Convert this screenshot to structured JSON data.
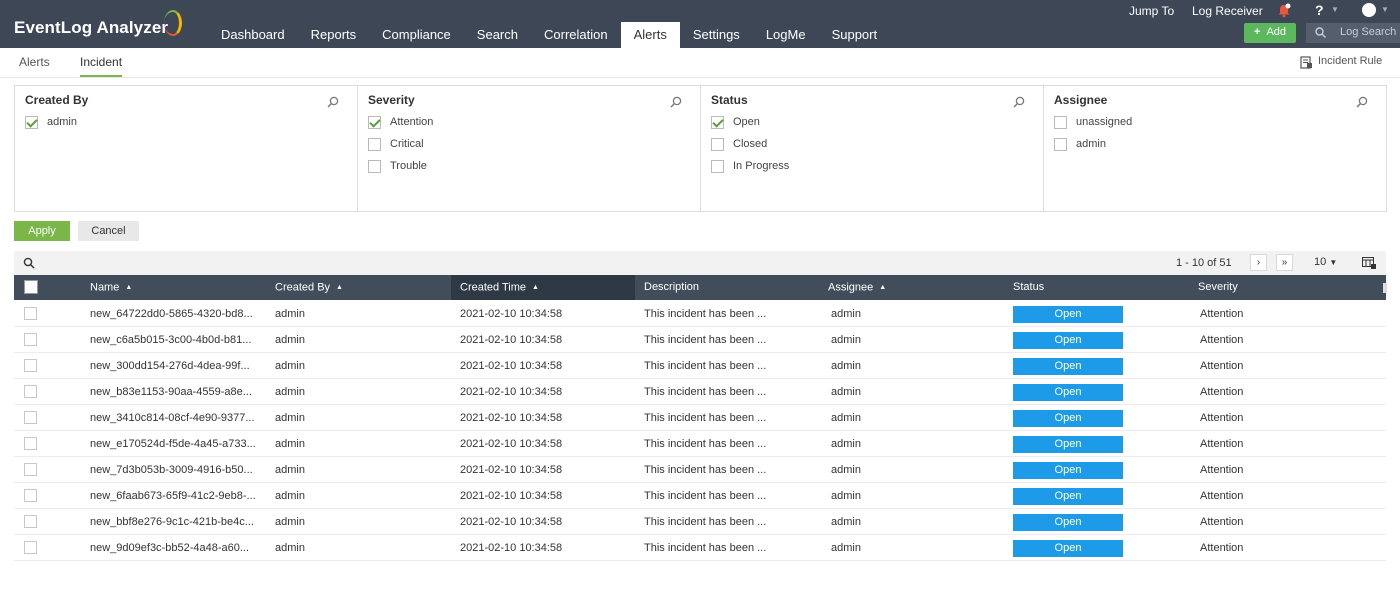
{
  "app": {
    "title": "EventLog Analyzer"
  },
  "nav": [
    {
      "label": "Dashboard",
      "active": false
    },
    {
      "label": "Reports",
      "active": false
    },
    {
      "label": "Compliance",
      "active": false
    },
    {
      "label": "Search",
      "active": false
    },
    {
      "label": "Correlation",
      "active": false
    },
    {
      "label": "Alerts",
      "active": true
    },
    {
      "label": "Settings",
      "active": false
    },
    {
      "label": "LogMe",
      "active": false
    },
    {
      "label": "Support",
      "active": false
    }
  ],
  "top_links": {
    "jump_to": "Jump To",
    "log_receiver": "Log Receiver",
    "help": "?",
    "add": "Add",
    "log_search_placeholder": "Log Search"
  },
  "subtabs": {
    "alerts": "Alerts",
    "incident": "Incident",
    "incident_rule": "Incident Rule"
  },
  "filters": [
    {
      "title": "Created By",
      "options": [
        {
          "label": "admin",
          "checked": true
        }
      ]
    },
    {
      "title": "Severity",
      "options": [
        {
          "label": "Attention",
          "checked": true
        },
        {
          "label": "Critical",
          "checked": false
        },
        {
          "label": "Trouble",
          "checked": false
        }
      ]
    },
    {
      "title": "Status",
      "options": [
        {
          "label": "Open",
          "checked": true
        },
        {
          "label": "Closed",
          "checked": false
        },
        {
          "label": "In Progress",
          "checked": false
        }
      ]
    },
    {
      "title": "Assignee",
      "options": [
        {
          "label": "unassigned",
          "checked": false
        },
        {
          "label": "admin",
          "checked": false
        }
      ]
    }
  ],
  "actions": {
    "apply": "Apply",
    "cancel": "Cancel"
  },
  "pager": {
    "range": "1 - 10 of 51",
    "next": "›",
    "last": "»",
    "per_page": "10"
  },
  "columns": {
    "name": "Name",
    "created_by": "Created By",
    "created_time": "Created Time",
    "description": "Description",
    "assignee": "Assignee",
    "status": "Status",
    "severity": "Severity"
  },
  "sort_glyph": "▲",
  "rows": [
    {
      "name": "new_64722dd0-5865-4320-bd8...",
      "created_by": "admin",
      "created_time": "2021-02-10 10:34:58",
      "description": "This incident has been ...",
      "assignee": "admin",
      "status": "Open",
      "severity": "Attention"
    },
    {
      "name": "new_c6a5b015-3c00-4b0d-b81...",
      "created_by": "admin",
      "created_time": "2021-02-10 10:34:58",
      "description": "This incident has been ...",
      "assignee": "admin",
      "status": "Open",
      "severity": "Attention"
    },
    {
      "name": "new_300dd154-276d-4dea-99f...",
      "created_by": "admin",
      "created_time": "2021-02-10 10:34:58",
      "description": "This incident has been ...",
      "assignee": "admin",
      "status": "Open",
      "severity": "Attention"
    },
    {
      "name": "new_b83e1153-90aa-4559-a8e...",
      "created_by": "admin",
      "created_time": "2021-02-10 10:34:58",
      "description": "This incident has been ...",
      "assignee": "admin",
      "status": "Open",
      "severity": "Attention"
    },
    {
      "name": "new_3410c814-08cf-4e90-9377...",
      "created_by": "admin",
      "created_time": "2021-02-10 10:34:58",
      "description": "This incident has been ...",
      "assignee": "admin",
      "status": "Open",
      "severity": "Attention"
    },
    {
      "name": "new_e170524d-f5de-4a45-a733...",
      "created_by": "admin",
      "created_time": "2021-02-10 10:34:58",
      "description": "This incident has been ...",
      "assignee": "admin",
      "status": "Open",
      "severity": "Attention"
    },
    {
      "name": "new_7d3b053b-3009-4916-b50...",
      "created_by": "admin",
      "created_time": "2021-02-10 10:34:58",
      "description": "This incident has been ...",
      "assignee": "admin",
      "status": "Open",
      "severity": "Attention"
    },
    {
      "name": "new_6faab673-65f9-41c2-9eb8-...",
      "created_by": "admin",
      "created_time": "2021-02-10 10:34:58",
      "description": "This incident has been ...",
      "assignee": "admin",
      "status": "Open",
      "severity": "Attention"
    },
    {
      "name": "new_bbf8e276-9c1c-421b-be4c...",
      "created_by": "admin",
      "created_time": "2021-02-10 10:34:58",
      "description": "This incident has been ...",
      "assignee": "admin",
      "status": "Open",
      "severity": "Attention"
    },
    {
      "name": "new_9d09ef3c-bb52-4a48-a60...",
      "created_by": "admin",
      "created_time": "2021-02-10 10:34:58",
      "description": "This incident has been ...",
      "assignee": "admin",
      "status": "Open",
      "severity": "Attention"
    }
  ],
  "colors": {
    "nav_bg": "#3d4756",
    "accent_green": "#7ab648",
    "status_open": "#1e9be8",
    "header_bg": "#424d5c"
  }
}
